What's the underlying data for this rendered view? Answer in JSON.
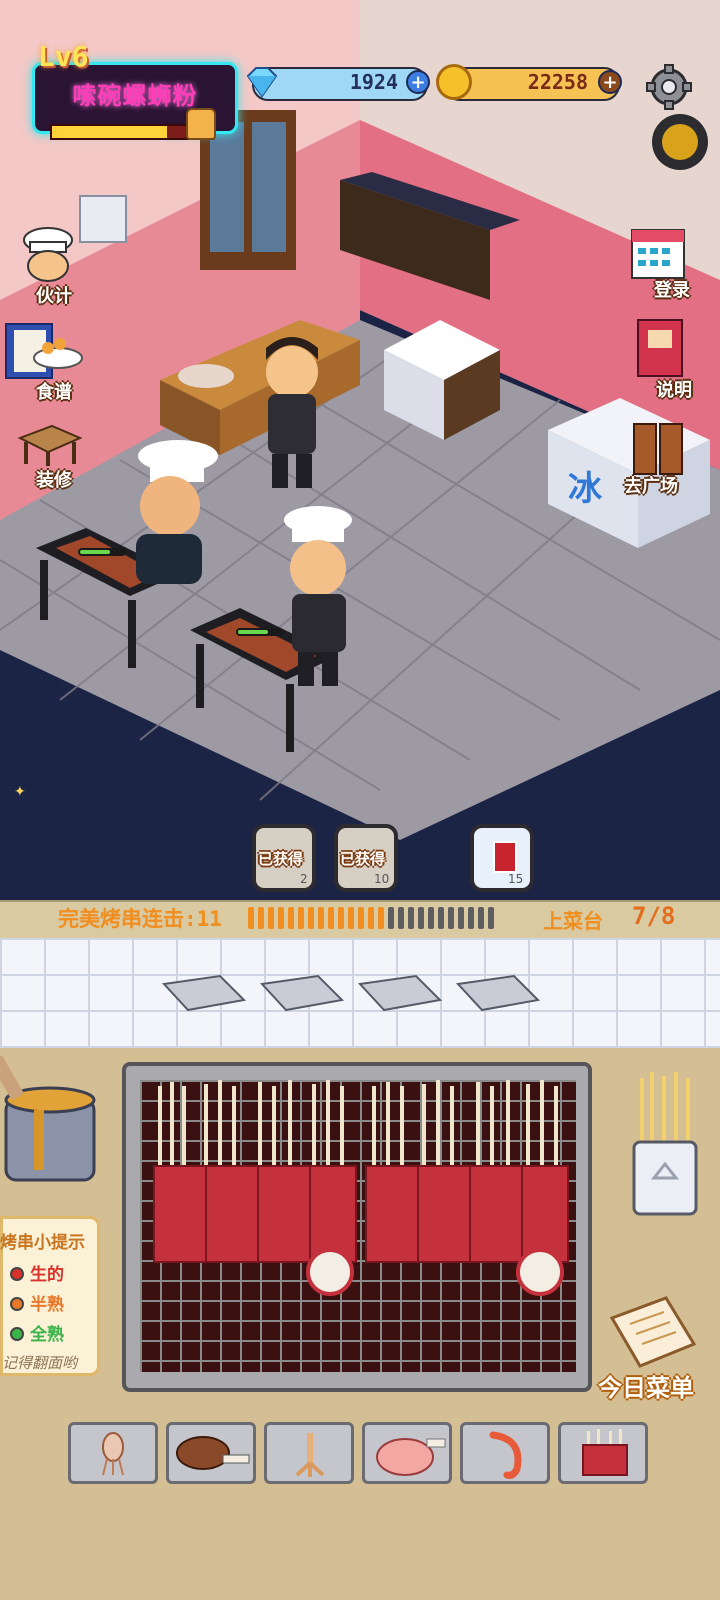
{
  "shop": {
    "level": "Lv6",
    "name": "嗦碗螺蛳粉",
    "level_progress": 0.72
  },
  "currency": {
    "diamonds": "1924",
    "gold": "22258",
    "plus_symbol": "+"
  },
  "side_left": [
    {
      "label": "伙计",
      "icon": "chef-icon"
    },
    {
      "label": "食谱",
      "icon": "recipe-book-icon"
    },
    {
      "label": "装修",
      "icon": "decor-icon"
    }
  ],
  "side_right": [
    {
      "label": "登录",
      "icon": "calendar-icon"
    },
    {
      "label": "说明",
      "icon": "guide-book-icon"
    },
    {
      "label": "去广场",
      "icon": "door-icon"
    }
  ],
  "bubbles": [
    {
      "label": "已获得",
      "count": "2"
    },
    {
      "label": "已获得",
      "count": "10"
    },
    {
      "label": "",
      "count": "15"
    }
  ],
  "combo": {
    "label": "完美烤串连击:11",
    "filled_segments": 14,
    "total_segments": 25
  },
  "serving": {
    "label": "上菜台",
    "value": "7/8"
  },
  "hints": {
    "title": "烤串小提示",
    "items": [
      {
        "label": "生的",
        "color": "#d9322b"
      },
      {
        "label": "半熟",
        "color": "#e8792a"
      },
      {
        "label": "全熟",
        "color": "#3bb44a"
      }
    ],
    "note": "记得翻面哟"
  },
  "menu_label": "今日菜单",
  "ingredients": [
    {
      "icon": "squid-icon"
    },
    {
      "icon": "meat-leg-icon"
    },
    {
      "icon": "chicken-feet-icon"
    },
    {
      "icon": "lamb-chop-icon"
    },
    {
      "icon": "shrimp-icon"
    },
    {
      "icon": "mushroom-beef-roll-icon"
    }
  ],
  "colors": {
    "accent_neon": "#36e6f0",
    "neon_text": "#ff3db7",
    "combo_orange": "#f08e1f",
    "grill_dark": "#3a1010"
  }
}
